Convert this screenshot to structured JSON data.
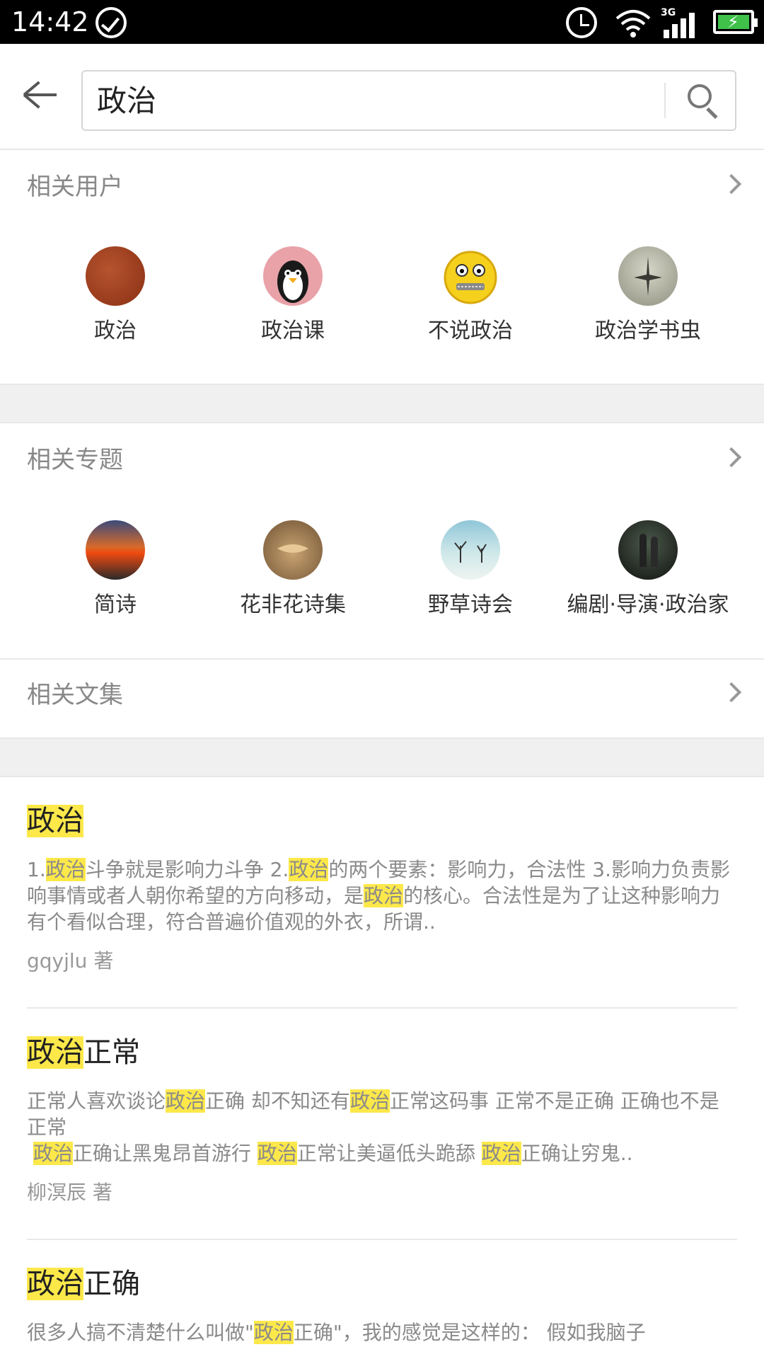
{
  "status": {
    "time": "14:42",
    "network": "3G"
  },
  "search": {
    "query": "政治"
  },
  "sections": {
    "users": {
      "title": "相关用户"
    },
    "topics": {
      "title": "相关专题"
    },
    "collections": {
      "title": "相关文集"
    }
  },
  "users": [
    {
      "name": "政治",
      "icon": "avatar-red-texture"
    },
    {
      "name": "政治课",
      "icon": "avatar-penguin"
    },
    {
      "name": "不说政治",
      "icon": "avatar-zipped-mouth-emoji"
    },
    {
      "name": "政治学书虫",
      "icon": "avatar-spinning-top"
    }
  ],
  "topics": [
    {
      "name": "简诗",
      "icon": "avatar-sunset"
    },
    {
      "name": "花非花诗集",
      "icon": "avatar-desert-leaf"
    },
    {
      "name": "野草诗会",
      "icon": "avatar-trees-snow"
    },
    {
      "name": "编剧·导演·政治家",
      "icon": "avatar-dark-film"
    }
  ],
  "articles": [
    {
      "title_parts": [
        {
          "t": "政治",
          "hl": true
        }
      ],
      "body_parts": [
        {
          "t": "1.",
          "hl": false
        },
        {
          "t": "政治",
          "hl": true
        },
        {
          "t": "斗争就是影响力斗争  2.",
          "hl": false
        },
        {
          "t": "政治",
          "hl": true
        },
        {
          "t": "的两个要素：影响力，合法性  3.影响力负责影响事情或者人朝你希望的方向移动，是",
          "hl": false
        },
        {
          "t": "政治",
          "hl": true
        },
        {
          "t": "的核心。合法性是为了让这种影响力有个看似合理，符合普遍价值观的外衣，所谓..",
          "hl": false
        }
      ],
      "author": "gqyjlu 著"
    },
    {
      "title_parts": [
        {
          "t": "政治",
          "hl": true
        },
        {
          "t": "正常",
          "hl": false
        }
      ],
      "body_parts": [
        {
          "t": "正常人喜欢谈论",
          "hl": false
        },
        {
          "t": "政治",
          "hl": true
        },
        {
          "t": "正确 却不知还有",
          "hl": false
        },
        {
          "t": "政治",
          "hl": true
        },
        {
          "t": "正常这码事 正常不是正确 正确也不是正常\n ",
          "hl": false
        },
        {
          "t": "政治",
          "hl": true
        },
        {
          "t": "正确让黑鬼昂首游行 ",
          "hl": false
        },
        {
          "t": "政治",
          "hl": true
        },
        {
          "t": "正常让美逼低头跪舔 ",
          "hl": false
        },
        {
          "t": "政治",
          "hl": true
        },
        {
          "t": "正确让穷鬼..",
          "hl": false
        }
      ],
      "author": "柳溟辰 著"
    },
    {
      "title_parts": [
        {
          "t": "政治",
          "hl": true
        },
        {
          "t": "正确",
          "hl": false
        }
      ],
      "body_parts": [
        {
          "t": "很多人搞不清楚什么叫做\"",
          "hl": false
        },
        {
          "t": "政治",
          "hl": true
        },
        {
          "t": "正确\"，我的感觉是这样的：  假如我脑子",
          "hl": false
        }
      ],
      "author": ""
    }
  ],
  "colors": {
    "highlight": "#fde84a",
    "battery": "#3fc14a"
  }
}
